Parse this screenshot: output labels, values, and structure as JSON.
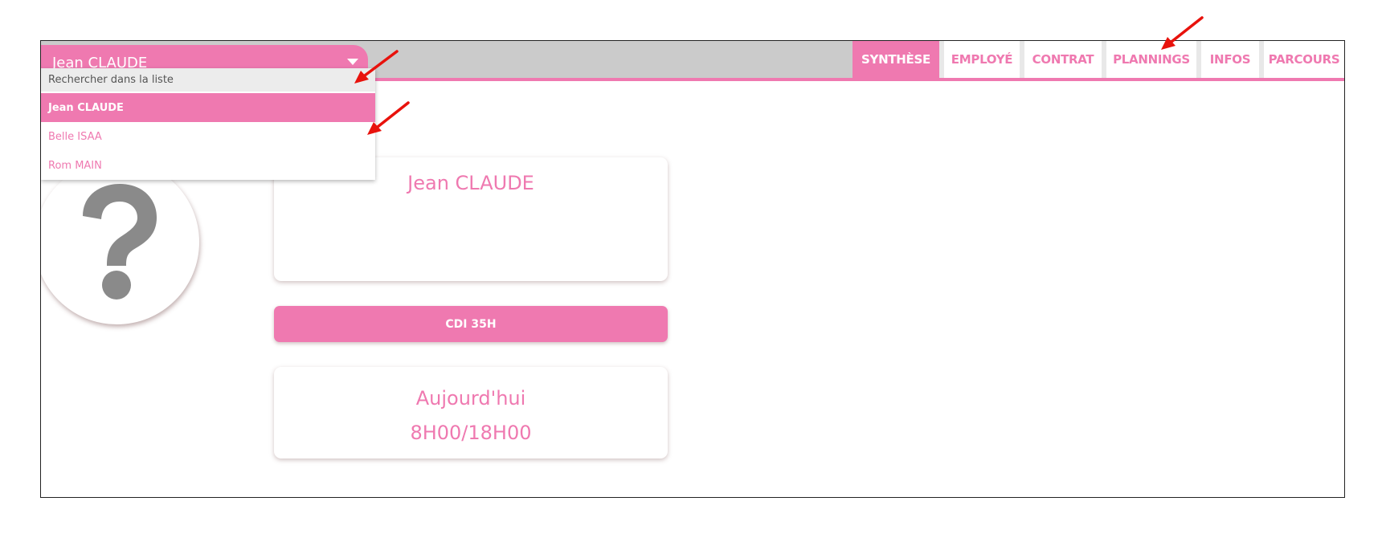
{
  "selector": {
    "current": "Jean CLAUDE",
    "search_placeholder": "Rechercher dans la liste",
    "options": [
      "Jean CLAUDE",
      "Belle ISAA",
      "Rom MAIN"
    ]
  },
  "tabs": [
    "SYNTHÈSE",
    "EMPLOYÉ",
    "CONTRAT",
    "PLANNINGS",
    "INFOS",
    "PARCOURS"
  ],
  "active_tab": "SYNTHÈSE",
  "avatar": {
    "icon": "question-mark-icon"
  },
  "employee_card": {
    "name": "Jean CLAUDE"
  },
  "contract": {
    "label": "CDI 35H"
  },
  "today_card": {
    "title": "Aujourd'hui",
    "hours": "8H00/18H00"
  },
  "colors": {
    "accent": "#ef79b0",
    "topbar": "#cbcbcb",
    "annotation_arrow": "#e8120c"
  }
}
